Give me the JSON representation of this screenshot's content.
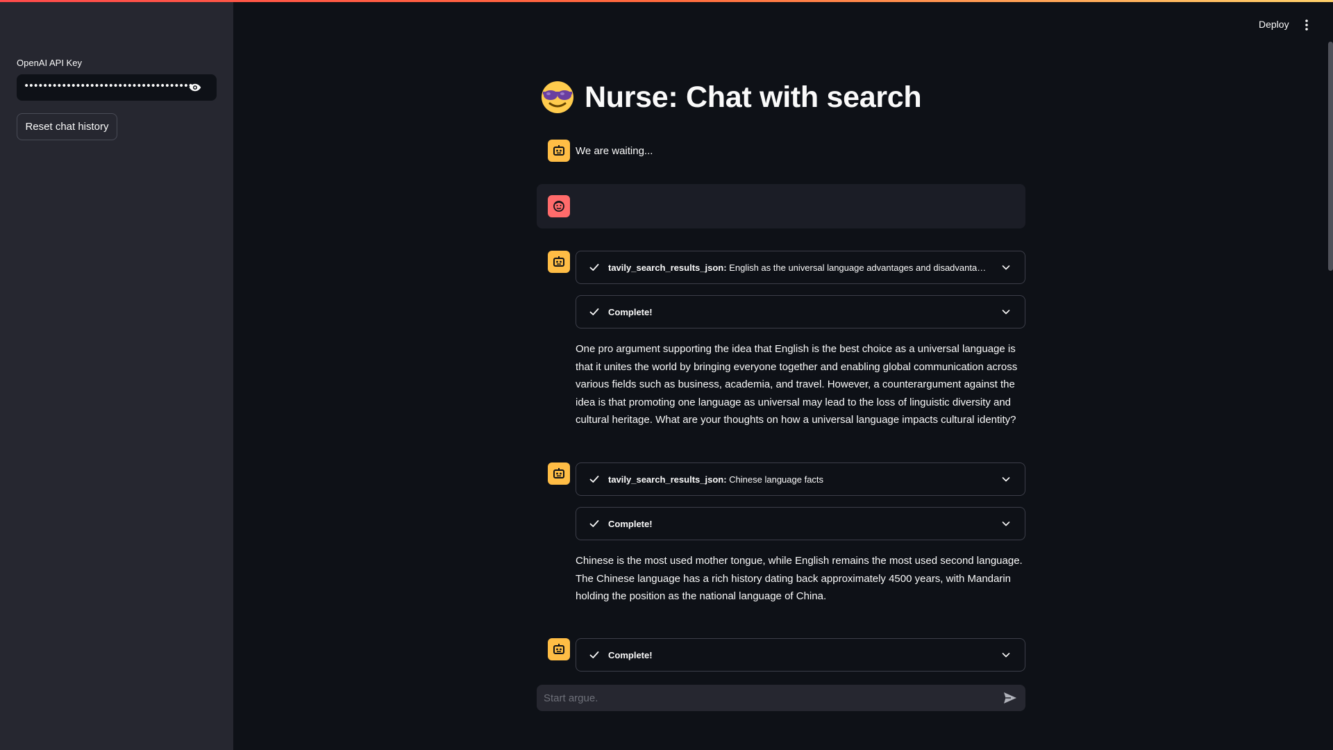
{
  "sidebar": {
    "api_key_label": "OpenAI API Key",
    "api_key_value": "••••••••••••••••••••••••••••••••••••••••••••••••••••",
    "reset_button": "Reset chat history"
  },
  "header": {
    "deploy_label": "Deploy"
  },
  "main": {
    "title": "Nurse: Chat with search",
    "messages": [
      {
        "role": "assistant",
        "text": "We are waiting..."
      },
      {
        "role": "user",
        "text": ""
      },
      {
        "role": "assistant",
        "tool_call": {
          "tool": "tavily_search_results_json:",
          "query": "English as the universal language advantages and disadvantag..."
        },
        "status": "Complete!",
        "text": "One pro argument supporting the idea that English is the best choice as a universal language is that it unites the world by bringing everyone together and enabling global communication across various fields such as business, academia, and travel. However, a counterargument against the idea is that promoting one language as universal may lead to the loss of linguistic diversity and cultural heritage. What are your thoughts on how a universal language impacts cultural identity?"
      },
      {
        "role": "assistant",
        "tool_call": {
          "tool": "tavily_search_results_json:",
          "query": "Chinese language facts"
        },
        "status": "Complete!",
        "text": "Chinese is the most used mother tongue, while English remains the most used second language. The Chinese language has a rich history dating back approximately 4500 years, with Mandarin holding the position as the national language of China."
      },
      {
        "role": "assistant",
        "status": "Complete!"
      }
    ]
  },
  "chat_input": {
    "placeholder": "Start argue."
  },
  "colors": {
    "background": "#0e1117",
    "sidebar": "#262730",
    "bot_avatar": "#ffbd45",
    "user_avatar": "#ff6b6b"
  }
}
